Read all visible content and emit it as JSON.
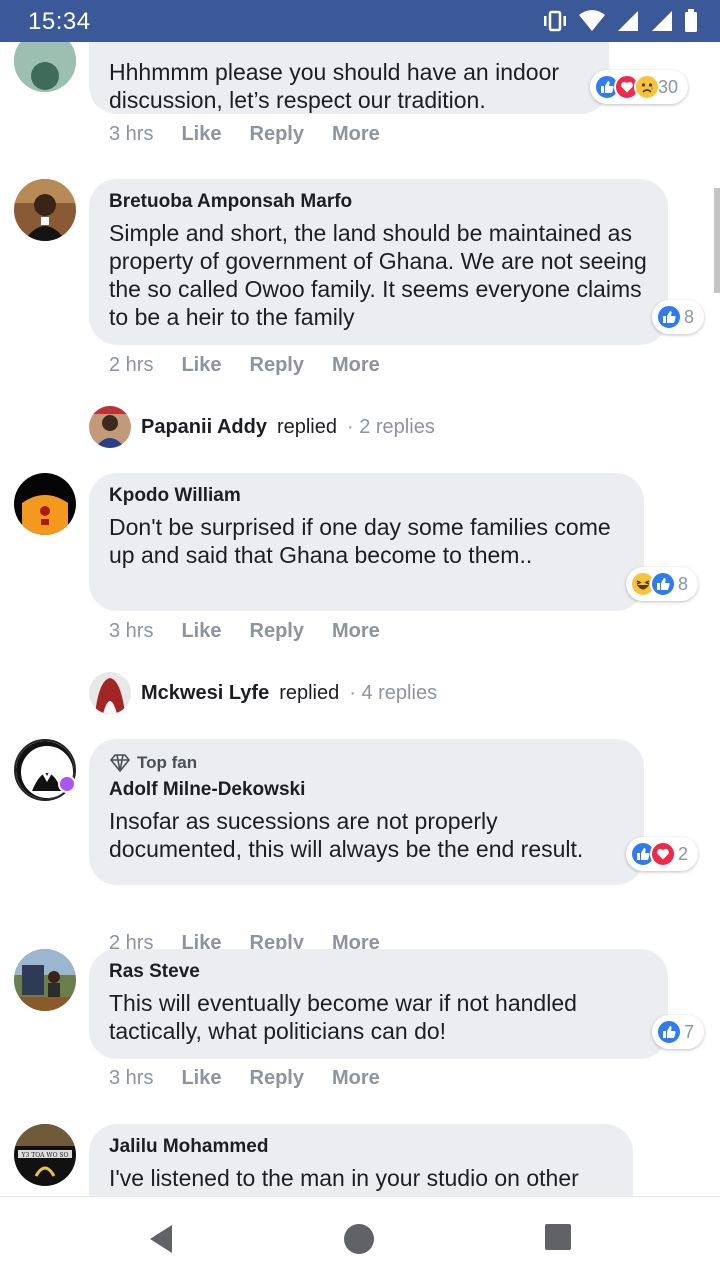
{
  "status": {
    "time": "15:34"
  },
  "actions_labels": {
    "like": "Like",
    "reply": "Reply",
    "more": "More"
  },
  "comments": [
    {
      "name": "",
      "text": "Hhhmmm please you should have an indoor discussion, let’s respect our tradition.",
      "time": "3 hrs",
      "reaction_count": "30",
      "reactions": [
        "like",
        "love",
        "sad"
      ]
    },
    {
      "name": "Bretuoba Amponsah Marfo",
      "text": "Simple and short, the land should be maintained as property of government of Ghana. We are not seeing the so called Owoo family. It seems everyone claims to be a heir to the family",
      "time": "2 hrs",
      "reaction_count": "8",
      "reactions": [
        "like"
      ]
    },
    {
      "name": "Kpodo William",
      "text": "Don't be surprised if one day some families come up and said that Ghana become to them..",
      "time": "3 hrs",
      "reaction_count": "8",
      "reactions": [
        "haha",
        "like"
      ]
    },
    {
      "badge": "Top fan",
      "name": "Adolf Milne-Dekowski",
      "text": "Insofar as sucessions are not properly documented, this will always be the end result.",
      "time": "2 hrs",
      "reaction_count": "2",
      "reactions": [
        "like",
        "love"
      ]
    },
    {
      "name": "Ras Steve",
      "text": "This will eventually become war if not handled tactically, what politicians can do!",
      "time": "3 hrs",
      "reaction_count": "7",
      "reactions": [
        "like"
      ]
    },
    {
      "name": "Jalilu Mohammed",
      "text": "I've listened to the man in your studio on other"
    }
  ],
  "replies": [
    {
      "name": "Papanii Addy",
      "verb": "replied",
      "count": "· 2 replies"
    },
    {
      "name": "Mckwesi Lyfe",
      "verb": "replied",
      "count": "· 4 replies"
    }
  ],
  "colors": {
    "accent": "#3b5998",
    "like": "#2e7bf2",
    "love": "#f0284a",
    "bubble": "#ebedf0"
  }
}
